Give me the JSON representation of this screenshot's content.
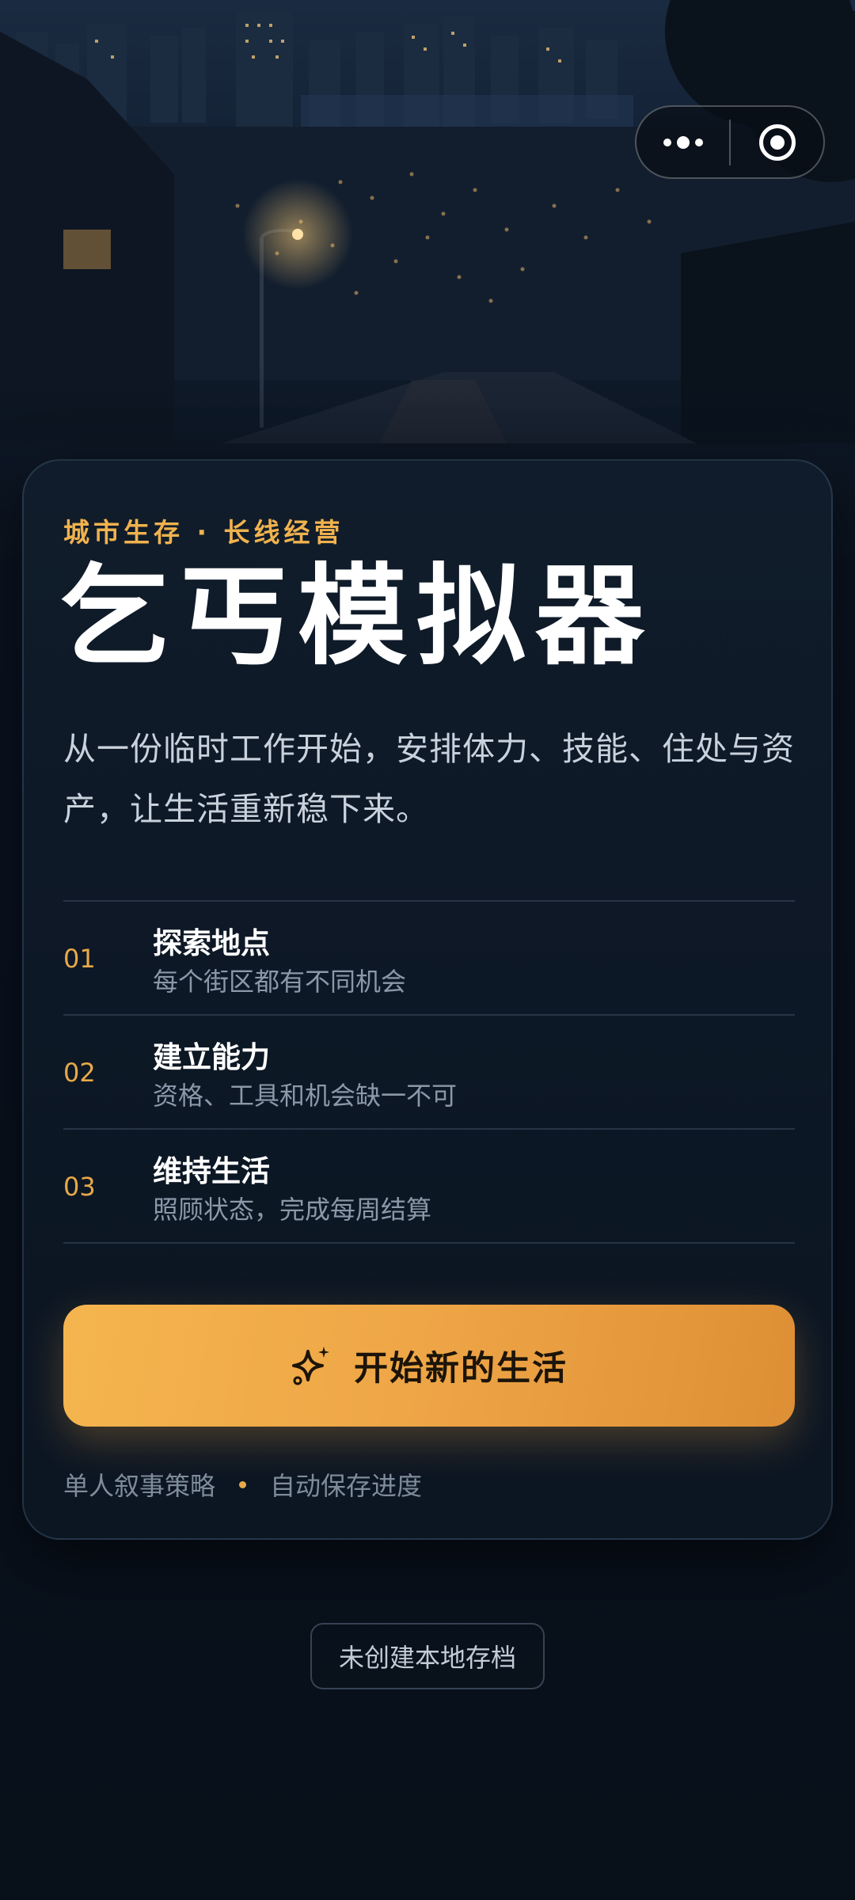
{
  "capsule": {
    "menu_icon": "more-dots-icon",
    "close_icon": "target-circle-icon"
  },
  "hero": {
    "scene": "night-city-background"
  },
  "card": {
    "eyebrow": "城市生存 · 长线经营",
    "title": "乞丐模拟器",
    "description": "从一份临时工作开始，安排体力、技能、住处与资产，让生活重新稳下来。",
    "steps": [
      {
        "num": "01",
        "title": "探索地点",
        "subtitle": "每个街区都有不同机会"
      },
      {
        "num": "02",
        "title": "建立能力",
        "subtitle": "资格、工具和机会缺一不可"
      },
      {
        "num": "03",
        "title": "维持生活",
        "subtitle": "照顾状态，完成每周结算"
      }
    ],
    "cta": {
      "icon": "sparkle-icon",
      "label": "开始新的生活"
    },
    "footnote": {
      "left": "单人叙事策略",
      "right": "自动保存进度"
    }
  },
  "save_status": "未创建本地存档",
  "colors": {
    "accent": "#f0b24e",
    "cta_start": "#f5b54e",
    "cta_end": "#de8f35",
    "background": "#08101a",
    "card": "#111d2c"
  }
}
